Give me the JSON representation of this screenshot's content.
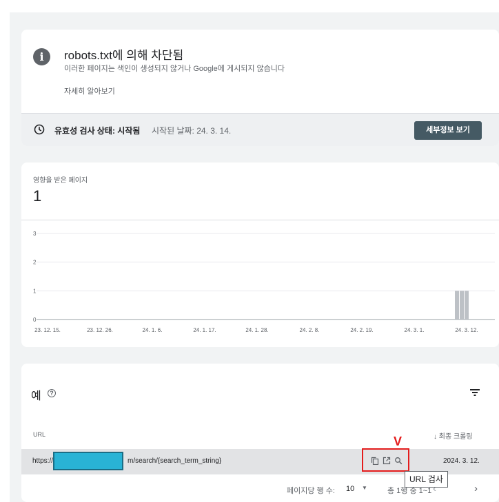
{
  "issue": {
    "title": "robots.txt에 의해 차단됨",
    "description": "이러한 페이지는 색인이 생성되지 않거나 Google에 게시되지 않습니다",
    "learn_more": "자세히 알아보기",
    "validation_label": "유효성 검사 상태: 시작됨",
    "validation_started": "시작된 날짜: 24. 3. 14.",
    "details_button": "세부정보 보기"
  },
  "affected": {
    "label": "영향을 받은 페이지",
    "value": "1"
  },
  "chart_data": {
    "type": "bar",
    "y_ticks": [
      "0",
      "1",
      "2",
      "3"
    ],
    "ylim": [
      0,
      3
    ],
    "x_tick_labels": [
      "23. 12. 15.",
      "23. 12. 26.",
      "24. 1. 6.",
      "24. 1. 17.",
      "24. 1. 28.",
      "24. 2. 8.",
      "24. 2. 19.",
      "24. 3. 1.",
      "24. 3. 12."
    ],
    "categories": [
      "24. 3. 12.",
      "24. 3. 13.",
      "24. 3. 14."
    ],
    "values": [
      1,
      1,
      1
    ],
    "bar_color": "#bdc1c6",
    "grid": true
  },
  "examples": {
    "title": "예",
    "col_url": "URL",
    "col_crawled": "↓ 최종 크롤링",
    "rows": [
      {
        "url": "https://",
        "url_tail": "m/search/{search_term_string}",
        "date": "2024. 3. 12."
      }
    ],
    "tooltip": "URL 검사",
    "annotation": "V"
  },
  "pagination": {
    "rows_label": "페이지당 행 수:",
    "rows_value": "10",
    "range": "총 1행 중 1~1",
    "prev": "‹",
    "next": "›"
  },
  "colors": {
    "accent_button": "#455a64",
    "highlight": "#e41c1c",
    "redact": "#29b3d5"
  }
}
